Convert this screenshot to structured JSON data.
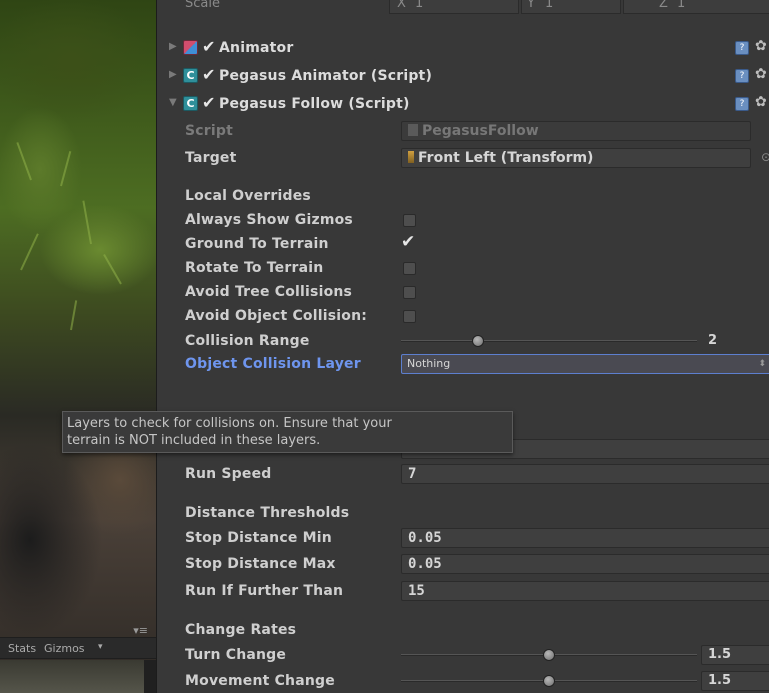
{
  "scene": {
    "toolbar": {
      "stats_label": "Stats",
      "gizmos_label": "Gizmos",
      "dropdown_glyph": "▾",
      "menu_glyph": "▾≡"
    }
  },
  "inspector": {
    "scale_row": {
      "label": "Scale",
      "x_label": "X",
      "x_value": "1",
      "y_label": "Y",
      "y_value": "1",
      "z_label": "Z",
      "z_value": "1"
    },
    "components": [
      {
        "title": "Animator",
        "enabled": true,
        "icon": "animator-icon",
        "expanded": false
      },
      {
        "title": "Pegasus Animator (Script)",
        "enabled": true,
        "icon": "script-icon",
        "expanded": false
      },
      {
        "title": "Pegasus Follow (Script)",
        "enabled": true,
        "icon": "script-icon",
        "expanded": true
      }
    ],
    "script_field": {
      "label": "Script",
      "value": "PegasusFollow"
    },
    "target_field": {
      "label": "Target",
      "value": "Front Left (Transform)"
    },
    "local_overrides": {
      "header": "Local Overrides",
      "always_show_gizmos": {
        "label": "Always Show Gizmos",
        "checked": false
      },
      "ground_to_terrain": {
        "label": "Ground To Terrain",
        "checked": true
      },
      "rotate_to_terrain": {
        "label": "Rotate To Terrain",
        "checked": false
      },
      "avoid_tree_collisions": {
        "label": "Avoid Tree Collisions",
        "checked": false
      },
      "avoid_object_collisions": {
        "label": "Avoid Object Collision:",
        "checked": false
      },
      "collision_range": {
        "label": "Collision Range",
        "value": "2",
        "slider_fraction": 0.26
      },
      "object_collision_layer": {
        "label": "Object Collision Layer",
        "value": "Nothing"
      }
    },
    "tooltip": {
      "line1": "Layers to check for collisions on. Ensure that your",
      "line2": "terrain is NOT included in these layers."
    },
    "run_speed": {
      "label": "Run Speed",
      "value": "7"
    },
    "distance_thresholds": {
      "header": "Distance Thresholds",
      "stop_distance_min": {
        "label": "Stop Distance Min",
        "value": "0.05"
      },
      "stop_distance_max": {
        "label": "Stop Distance Max",
        "value": "0.05"
      },
      "run_if_further_than": {
        "label": "Run If Further Than",
        "value": "15"
      }
    },
    "change_rates": {
      "header": "Change Rates",
      "turn_change": {
        "label": "Turn Change",
        "value": "1.5",
        "slider_fraction": 0.5
      },
      "movement_change": {
        "label": "Movement Change",
        "value": "1.5",
        "slider_fraction": 0.5
      }
    },
    "colors": {
      "background": "#383838",
      "highlight_label": "#6e95ee",
      "dropdown_border": "#5d7fcf"
    }
  }
}
